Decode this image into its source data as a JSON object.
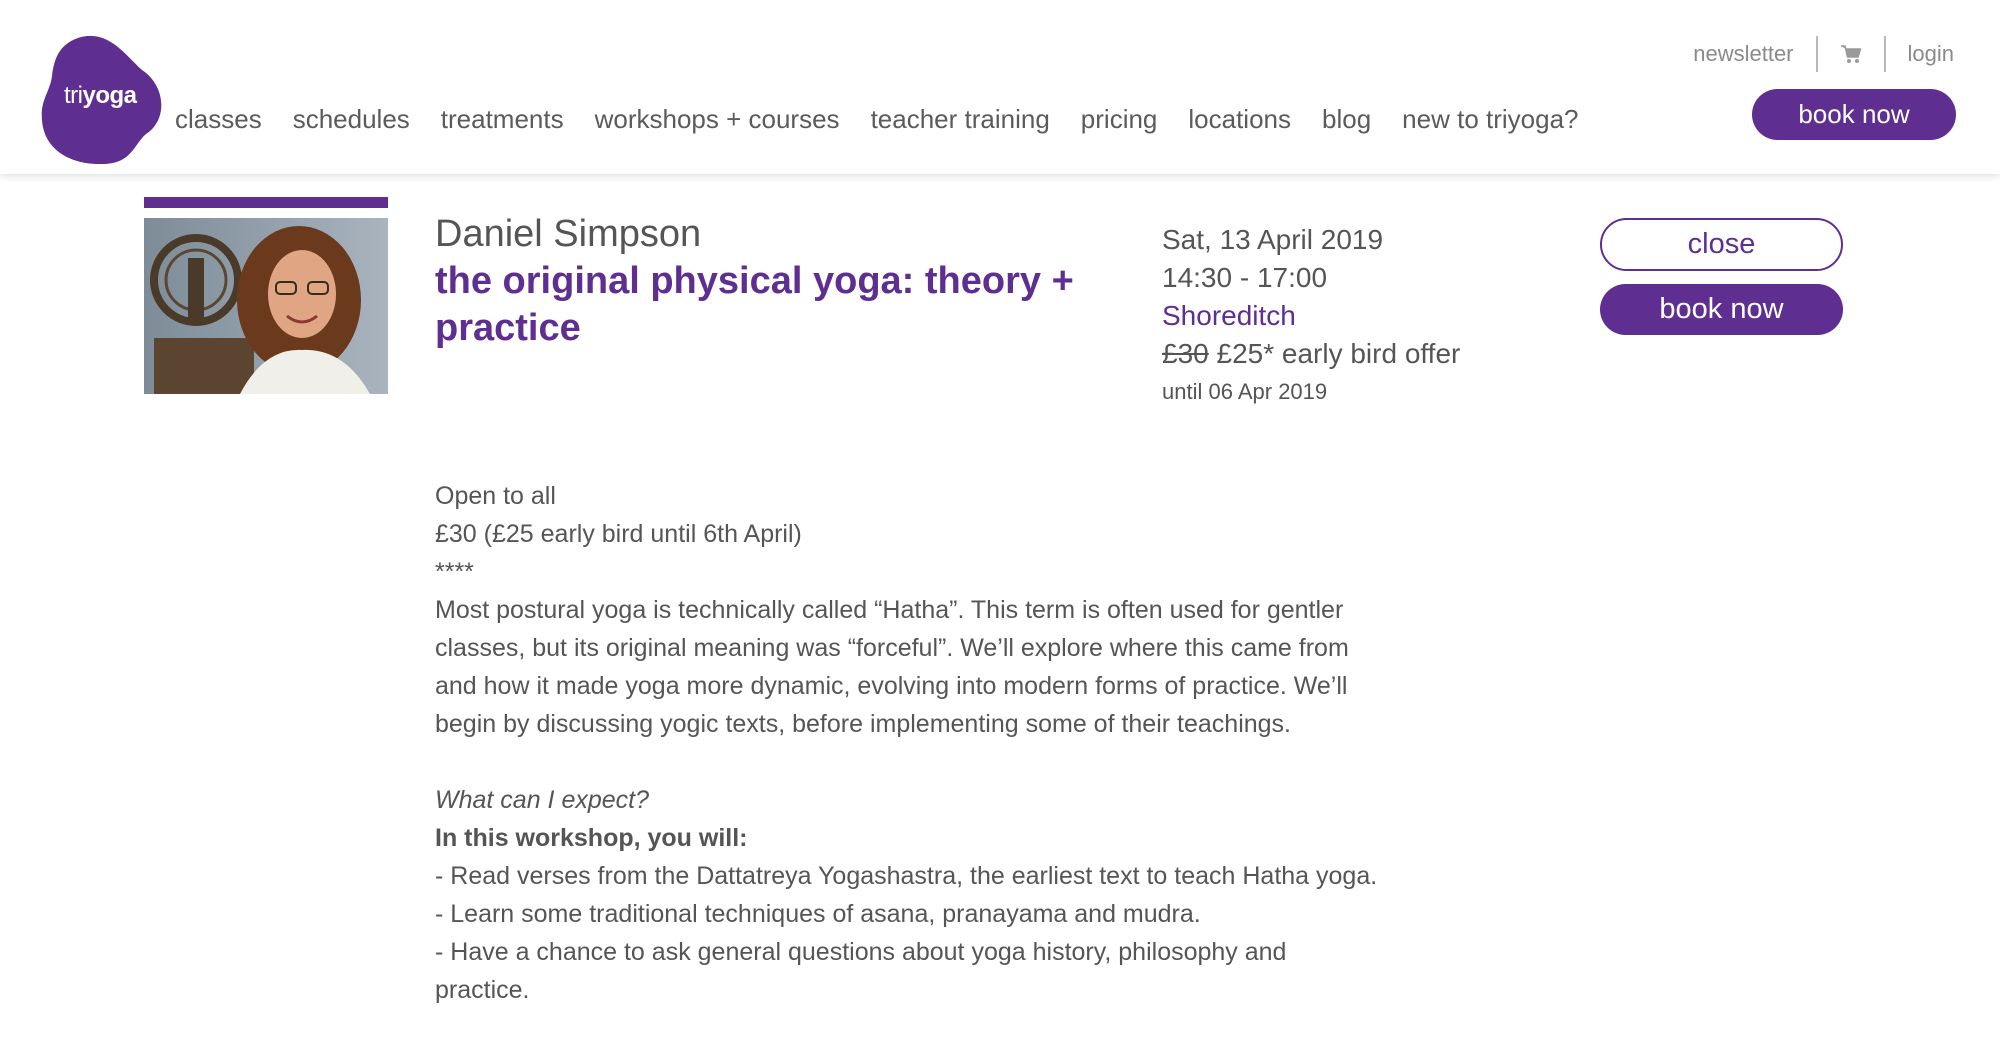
{
  "brand": {
    "logo_prefix": "tri",
    "logo_suffix": "yoga",
    "accent_color": "#5f2e91"
  },
  "nav": {
    "items": [
      "classes",
      "schedules",
      "treatments",
      "workshops + courses",
      "teacher training",
      "pricing",
      "locations",
      "blog",
      "new to triyoga?"
    ]
  },
  "top_links": {
    "newsletter": "newsletter",
    "login": "login",
    "cart_icon": "cart-icon"
  },
  "header_book": "book now",
  "event": {
    "teacher": "Daniel Simpson",
    "title": "the original physical yoga: theory + practice",
    "date": "Sat, 13 April 2019",
    "time": "14:30 - 17:00",
    "location": "Shoreditch",
    "old_price": "£30",
    "price_offer": "£25* early bird offer",
    "offer_until": "until 06 Apr 2019"
  },
  "buttons": {
    "close": "close",
    "book": "book now"
  },
  "description": {
    "open": "Open to all",
    "price_line": "£30 (£25 early bird until 6th April)",
    "stars": "****",
    "lines": [
      "Most postural yoga is technically called “Hatha”. This term is often used for gentler",
      "classes, but its original meaning was “forceful”. We’ll explore where this came from",
      "and how it made yoga more dynamic, evolving into modern forms of practice. We’ll",
      "begin by discussing yogic texts, before implementing some of their teachings."
    ],
    "expect": "What can I expect?",
    "will": "In this workshop, you will:",
    "bullets": [
      "- Read verses from the Dattatreya Yogashastra, the earliest text to teach Hatha yoga.",
      "- Learn some traditional techniques of asana, pranayama and mudra.",
      "- Have a chance to ask general questions about yoga history, philosophy and",
      "practice."
    ]
  }
}
